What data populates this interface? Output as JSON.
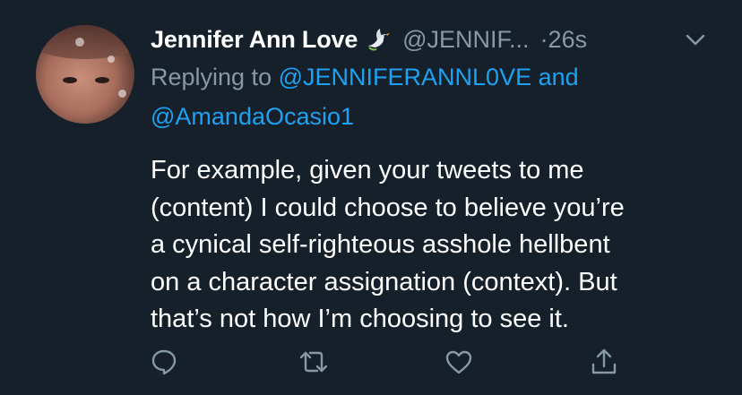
{
  "tweet": {
    "author_name": "Jennifer Ann Love",
    "author_handle": "@JENNIF...",
    "timestamp": "·26s",
    "reply_prefix": "Replying to",
    "reply_user_1": "@JENNIFERANNL0VE",
    "reply_joiner": "and",
    "reply_user_2": "@AmandaOcasio1",
    "body_lines": [
      "For example, given your tweets to me",
      "(content) I could choose to believe you’re",
      "a cynical self-righteous asshole hellbent",
      "on a character assignation (context). But",
      "that’s not how I’m choosing to see it."
    ]
  },
  "icons": {
    "badge": "dove-icon",
    "menu": "chevron-down-icon",
    "reply": "reply-icon",
    "retweet": "retweet-icon",
    "like": "heart-icon",
    "share": "share-icon"
  },
  "colors": {
    "background": "#15202b",
    "primary_text": "#ffffff",
    "secondary_text": "#8899a6",
    "link": "#1da1f2"
  }
}
